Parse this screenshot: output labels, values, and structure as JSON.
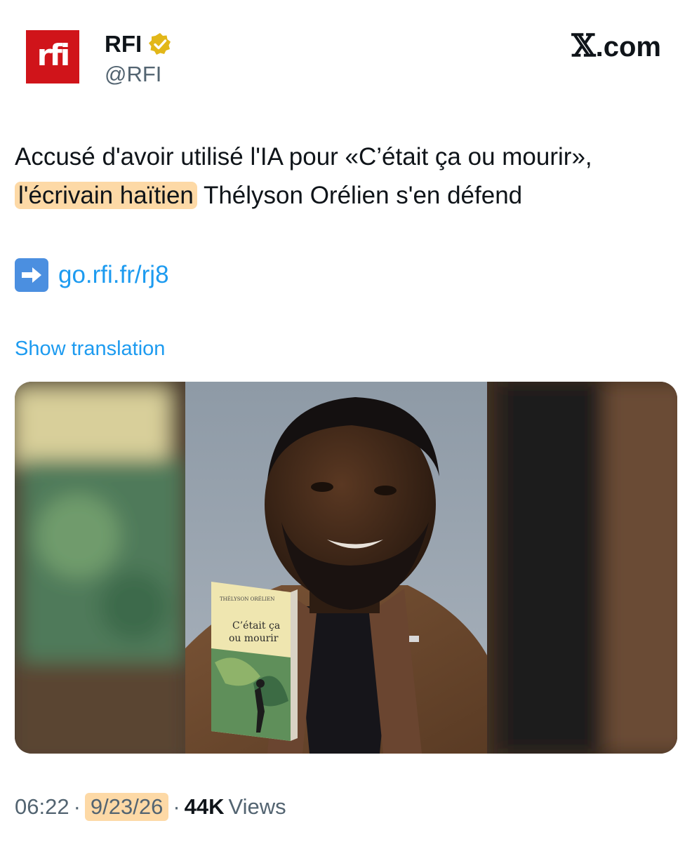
{
  "account": {
    "logo_text": "rfi",
    "name": "RFI",
    "handle": "@RFI"
  },
  "brand": {
    "mark": "𝕏",
    "suffix": ".com"
  },
  "tweet": {
    "text_before": "Accusé d'avoir utilisé l'IA pour «C’était ça ou mourir», ",
    "highlighted": "l'écrivain haïtien",
    "text_after": " Thélyson Orélien s'en défend",
    "link_icon": "right-arrow-emoji",
    "link": "go.rfi.fr/rj8",
    "show_translation": "Show translation"
  },
  "media": {
    "book_author": "THÉLYSON ORÉLIEN",
    "book_title_1": "C’était ça",
    "book_title_2": "ou mourir"
  },
  "meta": {
    "time": "06:22",
    "sep1": "·",
    "date": "9/23/26",
    "sep2": "·",
    "views_count": "44K",
    "views_label": "Views"
  },
  "colors": {
    "rfi_red": "#d0141a",
    "verified_gold": "#e2b719",
    "link_blue": "#1d9bf0",
    "highlight": "#fdd9a6"
  }
}
